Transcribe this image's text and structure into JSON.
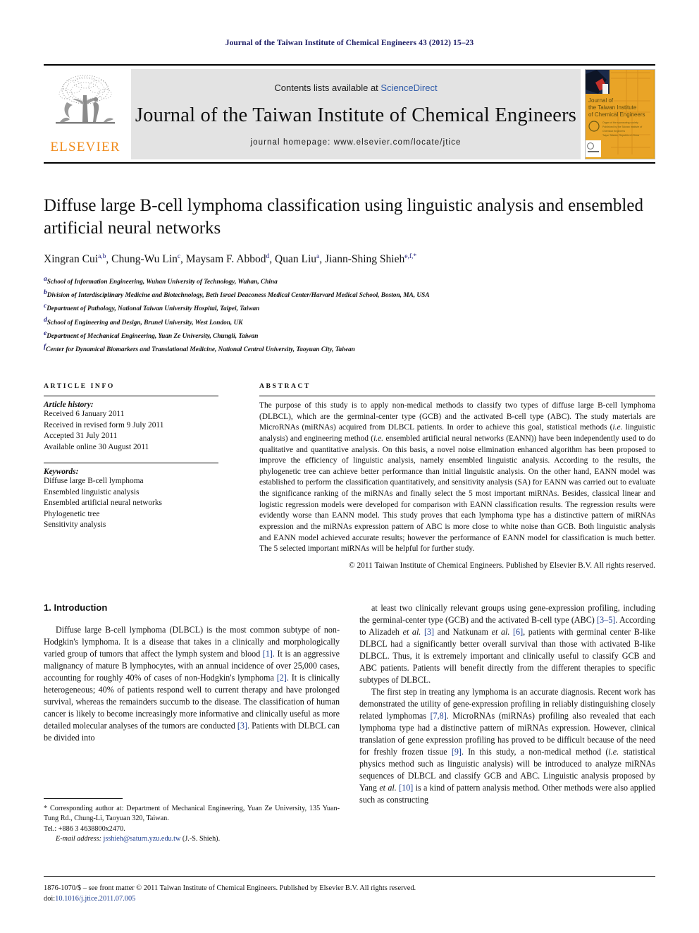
{
  "running_head": "Journal of the Taiwan Institute of Chemical Engineers 43 (2012) 15–23",
  "masthead": {
    "publisher_name": "ELSEVIER",
    "contents_prefix": "Contents lists available at ",
    "contents_link": "ScienceDirect",
    "journal_title": "Journal of the Taiwan Institute of Chemical Engineers",
    "homepage_line": "journal homepage: www.elsevier.com/locate/jtice",
    "cover_title_lines": [
      "Journal of",
      "the Taiwan Institute",
      "of Chemical Engineers"
    ],
    "accent_orange": "#F08C1E",
    "link_blue": "#2a57a8",
    "band_gray": "#e3e3e3"
  },
  "article": {
    "title": "Diffuse large B-cell lymphoma classification using linguistic analysis and ensembled artificial neural networks",
    "authors": [
      {
        "name": "Xingran Cui",
        "sup": "a,b",
        "sep": ", "
      },
      {
        "name": "Chung-Wu Lin",
        "sup": "c",
        "sep": ", "
      },
      {
        "name": "Maysam F. Abbod",
        "sup": "d",
        "sep": ", "
      },
      {
        "name": "Quan Liu",
        "sup": "a",
        "sep": ", "
      },
      {
        "name": "Jiann-Shing Shieh",
        "sup": "e,f,*",
        "sep": ""
      }
    ],
    "affiliations": [
      {
        "mark": "a",
        "text": "School of Information Engineering, Wuhan University of Technology, Wuhan, China"
      },
      {
        "mark": "b",
        "text": "Division of Interdisciplinary Medicine and Biotechnology, Beth Israel Deaconess Medical Center/Harvard Medical School, Boston, MA, USA"
      },
      {
        "mark": "c",
        "text": "Department of Pathology, National Taiwan University Hospital, Taipei, Taiwan"
      },
      {
        "mark": "d",
        "text": "School of Engineering and Design, Brunel University, West London, UK"
      },
      {
        "mark": "e",
        "text": "Department of Mechanical Engineering, Yuan Ze University, Chungli, Taiwan"
      },
      {
        "mark": "f",
        "text": "Center for Dynamical Biomarkers and Translational Medicine, National Central University, Taoyuan City, Taiwan"
      }
    ]
  },
  "article_info": {
    "heading": "ARTICLE INFO",
    "history_label": "Article history:",
    "history": [
      "Received 6 January 2011",
      "Received in revised form 9 July 2011",
      "Accepted 31 July 2011",
      "Available online 30 August 2011"
    ],
    "keywords_label": "Keywords:",
    "keywords": [
      "Diffuse large B-cell lymphoma",
      "Ensembled linguistic analysis",
      "Ensembled artificial neural networks",
      "Phylogenetic tree",
      "Sensitivity analysis"
    ]
  },
  "abstract": {
    "heading": "ABSTRACT",
    "text": "The purpose of this study is to apply non-medical methods to classify two types of diffuse large B-cell lymphoma (DLBCL), which are the germinal-center type (GCB) and the activated B-cell type (ABC). The study materials are MicroRNAs (miRNAs) acquired from DLBCL patients. In order to achieve this goal, statistical methods (i.e. linguistic analysis) and engineering method (i.e. ensembled artificial neural networks (EANN)) have been independently used to do qualitative and quantitative analysis. On this basis, a novel noise elimination enhanced algorithm has been proposed to improve the efficiency of linguistic analysis, namely ensembled linguistic analysis. According to the results, the phylogenetic tree can achieve better performance than initial linguistic analysis. On the other hand, EANN model was established to perform the classification quantitatively, and sensitivity analysis (SA) for EANN was carried out to evaluate the significance ranking of the miRNAs and finally select the 5 most important miRNAs. Besides, classical linear and logistic regression models were developed for comparison with EANN classification results. The regression results were evidently worse than EANN model. This study proves that each lymphoma type has a distinctive pattern of miRNAs expression and the miRNAs expression pattern of ABC is more close to white noise than GCB. Both linguistic analysis and EANN model achieved accurate results; however the performance of EANN model for classification is much better. The 5 selected important miRNAs will be helpful for further study.",
    "copyright": "© 2011 Taiwan Institute of Chemical Engineers. Published by Elsevier B.V. All rights reserved."
  },
  "section": {
    "number_title": "1. Introduction",
    "left_paragraphs": [
      "Diffuse large B-cell lymphoma (DLBCL) is the most common subtype of non-Hodgkin's lymphoma. It is a disease that takes in a clinically and morphologically varied group of tumors that affect the lymph system and blood [1]. It is an aggressive malignancy of mature B lymphocytes, with an annual incidence of over 25,000 cases, accounting for roughly 40% of cases of non-Hodgkin's lymphoma [2]. It is clinically heterogeneous; 40% of patients respond well to current therapy and have prolonged survival, whereas the remainders succumb to the disease. The classification of human cancer is likely to become increasingly more informative and clinically useful as more detailed molecular analyses of the tumors are conducted [3]. Patients with DLBCL can be divided into"
    ],
    "right_paragraphs": [
      "at least two clinically relevant groups using gene-expression profiling, including the germinal-center type (GCB) and the activated B-cell type (ABC) [3–5]. According to Alizadeh et al. [3] and Natkunam et al. [6], patients with germinal center B-like DLBCL had a significantly better overall survival than those with activated B-like DLBCL. Thus, it is extremely important and clinically useful to classify GCB and ABC patients. Patients will benefit directly from the different therapies to specific subtypes of DLBCL.",
      "The first step in treating any lymphoma is an accurate diagnosis. Recent work has demonstrated the utility of gene-expression profiling in reliably distinguishing closely related lymphomas [7,8]. MicroRNAs (miRNAs) profiling also revealed that each lymphoma type had a distinctive pattern of miRNAs expression. However, clinical translation of gene expression profiling has proved to be difficult because of the need for freshly frozen tissue [9]. In this study, a non-medical method (i.e. statistical physics method such as linguistic analysis) will be introduced to analyze miRNAs sequences of DLBCL and classify GCB and ABC. Linguistic analysis proposed by Yang et al. [10] is a kind of pattern analysis method. Other methods were also applied such as constructing"
    ]
  },
  "footnote": {
    "corresponding": "* Corresponding author at: Department of Mechanical Engineering, Yuan Ze University, 135 Yuan-Tung Rd., Chung-Li, Taoyuan 320, Taiwan.",
    "tel": "Tel.: +886 3 4638800x2470.",
    "email_label": "E-mail address:",
    "email": "jsshieh@saturn.yzu.edu.tw",
    "email_owner": "(J.-S. Shieh)."
  },
  "footer": {
    "issn_line": "1876-1070/$ – see front matter © 2011 Taiwan Institute of Chemical Engineers. Published by Elsevier B.V. All rights reserved.",
    "doi_label": "doi:",
    "doi": "10.1016/j.jtice.2011.07.005"
  }
}
